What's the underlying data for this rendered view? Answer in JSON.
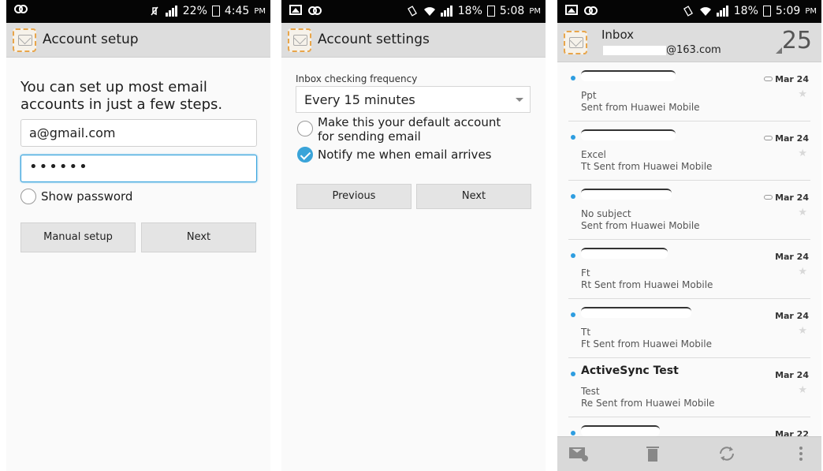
{
  "screen1": {
    "status": {
      "signal_pct": "22%",
      "time": "4:45",
      "ampm": "PM"
    },
    "title": "Account setup",
    "intro": "You can set up most email accounts in just a few steps.",
    "email_value": "a@gmail.com",
    "password_value": "••••••",
    "show_password_label": "Show password",
    "manual_setup_label": "Manual setup",
    "next_label": "Next"
  },
  "screen2": {
    "status": {
      "signal_pct": "18%",
      "time": "5:08",
      "ampm": "PM"
    },
    "title": "Account settings",
    "frequency_label": "Inbox checking frequency",
    "frequency_value": "Every 15 minutes",
    "default_account_label": "Make this your default account for sending email",
    "notify_label": "Notify me when email arrives",
    "previous_label": "Previous",
    "next_label": "Next"
  },
  "screen3": {
    "status": {
      "signal_pct": "18%",
      "time": "5:09",
      "ampm": "PM"
    },
    "title": "Inbox",
    "account": "@163.com",
    "count": "25",
    "emails": [
      {
        "sender": "",
        "subject": "Ppt",
        "preview": "Sent from Huawei Mobile",
        "date": "Mar 24",
        "attachment": true
      },
      {
        "sender": "",
        "subject": "Excel",
        "preview": "Tt Sent from Huawei Mobile",
        "date": "Mar 24",
        "attachment": true
      },
      {
        "sender": "",
        "subject": "No subject",
        "preview": "Sent from Huawei Mobile",
        "date": "Mar 24",
        "attachment": true
      },
      {
        "sender": "",
        "subject": "Ft",
        "preview": "Rt Sent from Huawei Mobile",
        "date": "Mar 24",
        "attachment": false
      },
      {
        "sender": "",
        "subject": "Tt",
        "preview": "Ft Sent from Huawei Mobile",
        "date": "Mar 24",
        "attachment": false
      },
      {
        "sender": "ActiveSync Test",
        "subject": "Test",
        "preview": "Re Sent from Huawei Mobile",
        "date": "Mar 24",
        "attachment": false
      },
      {
        "sender": "",
        "subject": "",
        "preview": "",
        "date": "Mar 22",
        "attachment": false
      }
    ]
  },
  "icons": {
    "compose": "compose-icon",
    "delete": "trash-icon",
    "refresh": "refresh-icon",
    "overflow": "overflow-menu-icon"
  },
  "colors": {
    "accent": "#36a3de",
    "unread_dot": "#2e9de0",
    "app_icon_border": "#e8a54a",
    "action_bar": "#dddddd",
    "status_bar": "#050505"
  }
}
